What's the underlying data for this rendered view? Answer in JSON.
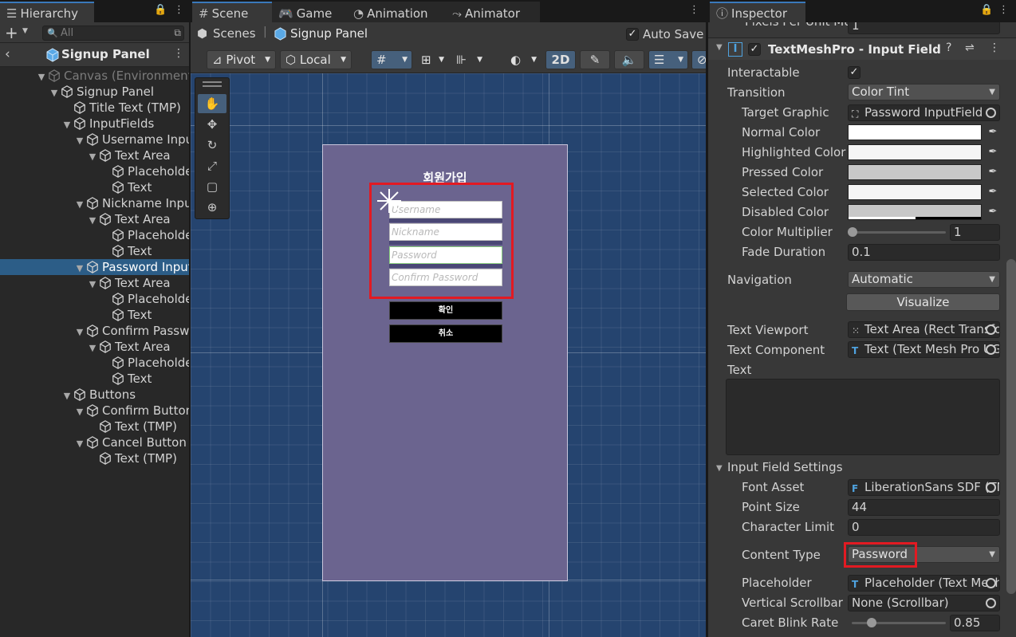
{
  "hierarchy": {
    "tab_label": "Hierarchy",
    "search_placeholder": "All",
    "breadcrumb": "Signup Panel",
    "items": [
      {
        "label": "Canvas (Environment)",
        "depth": 0,
        "expanded": true,
        "dim": true
      },
      {
        "label": "Signup Panel",
        "depth": 1,
        "expanded": true
      },
      {
        "label": "Title Text (TMP)",
        "depth": 2,
        "expanded": false,
        "leaf": true
      },
      {
        "label": "InputFields",
        "depth": 2,
        "expanded": true
      },
      {
        "label": "Username InputField",
        "depth": 3,
        "expanded": true
      },
      {
        "label": "Text Area",
        "depth": 4,
        "expanded": true
      },
      {
        "label": "Placeholder",
        "depth": 5,
        "leaf": true
      },
      {
        "label": "Text",
        "depth": 5,
        "leaf": true
      },
      {
        "label": "Nickname InputField",
        "depth": 3,
        "expanded": true
      },
      {
        "label": "Text Area",
        "depth": 4,
        "expanded": true
      },
      {
        "label": "Placeholder",
        "depth": 5,
        "leaf": true
      },
      {
        "label": "Text",
        "depth": 5,
        "leaf": true
      },
      {
        "label": "Password InputField",
        "depth": 3,
        "expanded": true,
        "selected": true
      },
      {
        "label": "Text Area",
        "depth": 4,
        "expanded": true
      },
      {
        "label": "Placeholder",
        "depth": 5,
        "leaf": true
      },
      {
        "label": "Text",
        "depth": 5,
        "leaf": true
      },
      {
        "label": "Confirm Password InputField",
        "depth": 3,
        "expanded": true
      },
      {
        "label": "Text Area",
        "depth": 4,
        "expanded": true
      },
      {
        "label": "Placeholder",
        "depth": 5,
        "leaf": true
      },
      {
        "label": "Text",
        "depth": 5,
        "leaf": true
      },
      {
        "label": "Buttons",
        "depth": 2,
        "expanded": true
      },
      {
        "label": "Confirm Button",
        "depth": 3,
        "expanded": true
      },
      {
        "label": "Text (TMP)",
        "depth": 4,
        "leaf": true
      },
      {
        "label": "Cancel Button",
        "depth": 3,
        "expanded": true
      },
      {
        "label": "Text (TMP)",
        "depth": 4,
        "leaf": true
      }
    ]
  },
  "scene": {
    "tabs": [
      "Scene",
      "Game",
      "Animation",
      "Animator"
    ],
    "breadcrumb_root": "Scenes",
    "breadcrumb_current": "Signup Panel",
    "auto_save_label": "Auto Save",
    "pivot_label": "Pivot",
    "local_label": "Local",
    "mode_2d_label": "2D",
    "canvas": {
      "title": "회원가입",
      "fields": [
        "Username",
        "Nickname",
        "Password",
        "Confirm Password"
      ],
      "confirm_button": "확인",
      "cancel_button": "취소"
    }
  },
  "inspector": {
    "tab_label": "Inspector",
    "top_cut_label": "Pixels Per Unit Mu",
    "top_cut_value": "1",
    "component_title": "TextMeshPro - Input Field",
    "interactable_label": "Interactable",
    "transition_label": "Transition",
    "transition_value": "Color Tint",
    "target_graphic_label": "Target Graphic",
    "target_graphic_value": "Password InputField",
    "normal_color_label": "Normal Color",
    "highlighted_color_label": "Highlighted Color",
    "pressed_color_label": "Pressed Color",
    "selected_color_label": "Selected Color",
    "disabled_color_label": "Disabled Color",
    "color_multiplier_label": "Color Multiplier",
    "color_multiplier_value": "1",
    "fade_duration_label": "Fade Duration",
    "fade_duration_value": "0.1",
    "navigation_label": "Navigation",
    "navigation_value": "Automatic",
    "visualize_label": "Visualize",
    "text_viewport_label": "Text Viewport",
    "text_viewport_value": "Text Area (Rect Transform)",
    "text_component_label": "Text Component",
    "text_component_value": "Text (Text Mesh Pro UGUI)",
    "text_label": "Text",
    "input_field_settings_label": "Input Field Settings",
    "font_asset_label": "Font Asset",
    "font_asset_value": "LiberationSans SDF (TMP_FontAsset)",
    "point_size_label": "Point Size",
    "point_size_value": "44",
    "character_limit_label": "Character Limit",
    "character_limit_value": "0",
    "content_type_label": "Content Type",
    "content_type_value": "Password",
    "placeholder_label": "Placeholder",
    "placeholder_value": "Placeholder (Text Mesh Pro UGUI)",
    "vertical_scrollbar_label": "Vertical Scrollbar",
    "vertical_scrollbar_value": "None (Scrollbar)",
    "caret_blink_rate_label": "Caret Blink Rate",
    "caret_blink_rate_value": "0.85",
    "colors": {
      "normal": "#ffffff",
      "highlighted": "#f5f5f5",
      "pressed": "#c8c8c8",
      "selected": "#f5f5f5",
      "disabled": "#c8c8c8"
    }
  }
}
